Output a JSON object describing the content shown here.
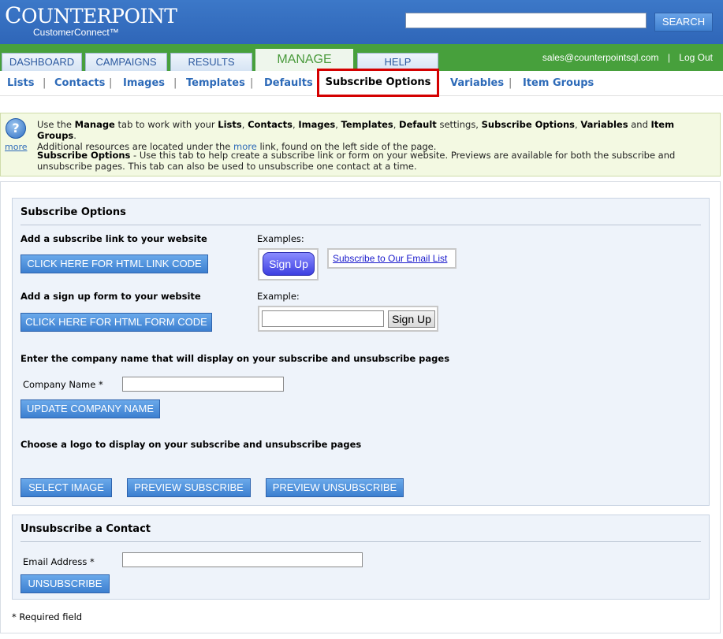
{
  "header": {
    "logo_text_big": "C",
    "logo_text": "OUNTERPOINT",
    "logo_sub": "CustomerConnect™",
    "search_value": "",
    "search_button": "SEARCH"
  },
  "tabs": [
    {
      "label": "DASHBOARD",
      "active": false
    },
    {
      "label": "CAMPAIGNS",
      "active": false
    },
    {
      "label": "RESULTS",
      "active": false
    },
    {
      "label": "MANAGE",
      "active": true
    },
    {
      "label": "HELP",
      "active": false
    }
  ],
  "user": {
    "email": "sales@counterpointsql.com",
    "separator": "|",
    "logout": "Log Out"
  },
  "subnav": {
    "items": [
      "Lists",
      "Contacts",
      "Images",
      "Templates",
      "Defaults",
      "Subscribe Options",
      "Variables",
      "Item Groups"
    ],
    "separator": "|",
    "active": "Subscribe Options"
  },
  "info": {
    "icon_glyph": "?",
    "more_link": "more",
    "line1_pre": "Use the ",
    "line1_manage": "Manage",
    "line1_mid": " tab to work with your ",
    "line1_items": "Lists",
    "line1_c1": ", ",
    "line1_contacts": "Contacts",
    "line1_c2": ", ",
    "line1_images": "Images",
    "line1_c3": ", ",
    "line1_templates": "Templates",
    "line1_c4": ", ",
    "line1_default": "Default",
    "line1_settings": " settings, ",
    "line1_subscribe": "Subscribe Options",
    "line1_c5": ", ",
    "line1_variables": "Variables",
    "line1_and": " and ",
    "line1_itemgroups": "Item Groups",
    "line1_end": ".",
    "line2_pre": "Additional resources are located under the ",
    "line2_link": "more",
    "line2_post": " link, found on the left side of the page.",
    "para2_title": "Subscribe Options",
    "para2_text": " - Use this tab to help create a subscribe link or form on your website. Previews are available for both the subscribe and unsubscribe pages. This tab can also be used to unsubscribe one contact at a time."
  },
  "subscribe_panel": {
    "title": "Subscribe Options",
    "link_heading": "Add a subscribe link to your website",
    "link_button": "CLICK HERE FOR HTML LINK CODE",
    "examples_label": "Examples:",
    "example_pill": "Sign Up",
    "example_link": "Subscribe to Our Email List",
    "form_heading": "Add a sign up form to your website",
    "form_button": "CLICK HERE FOR HTML FORM CODE",
    "example_label": "Example:",
    "example_form_value": "",
    "example_form_button": "Sign Up",
    "company_heading": "Enter the company name that will display on your subscribe and unsubscribe pages",
    "company_label": "Company Name *",
    "company_value": "",
    "company_button": "UPDATE COMPANY NAME",
    "logo_heading": "Choose a logo to display on your subscribe and unsubscribe pages",
    "select_image": "SELECT IMAGE",
    "preview_subscribe": "PREVIEW SUBSCRIBE",
    "preview_unsubscribe": "PREVIEW UNSUBSCRIBE"
  },
  "unsubscribe_panel": {
    "title": "Unsubscribe a Contact",
    "email_label": "Email Address *",
    "email_value": "",
    "button": "UNSUBSCRIBE"
  },
  "required_note": "* Required field",
  "colors": {
    "header_blue": "#3c78c8",
    "tabbar_green": "#47a03c",
    "link_blue": "#2d6ab8",
    "highlight_red": "#d40000",
    "button_blue": "#3c7fd0"
  }
}
